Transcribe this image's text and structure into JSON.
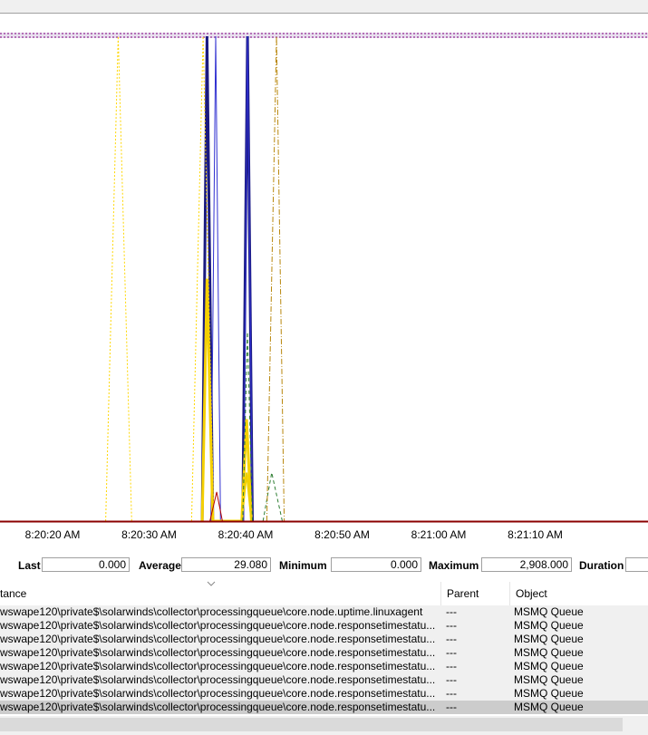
{
  "chart_data": {
    "type": "line",
    "x_tick_labels": [
      "8:20:20 AM",
      "8:20:30 AM",
      "8:20:40 AM",
      "8:20:50 AM",
      "8:21:00 AM",
      "8:21:10 AM"
    ],
    "grid": false,
    "vertical_scale": "100 = top of plot",
    "series": [
      {
        "color": "#1a1a80",
        "style": "solid-thick",
        "points": [
          [
            "8:20:35.5",
            0
          ],
          [
            "8:20:36",
            100
          ],
          [
            "8:20:36.6",
            0
          ],
          [
            "8:20:39.7",
            0
          ],
          [
            "8:20:40.2",
            100
          ],
          [
            "8:20:40.7",
            0
          ]
        ]
      },
      {
        "color": "#2f2fd0",
        "style": "solid-thin",
        "points": [
          [
            "8:20:36.4",
            0
          ],
          [
            "8:20:36.9",
            100
          ],
          [
            "8:20:37.4",
            0
          ],
          [
            "8:20:39.8",
            0
          ],
          [
            "8:20:40.2",
            100
          ],
          [
            "8:20:40.7",
            0
          ]
        ]
      },
      {
        "color": "#f5d000",
        "style": "solid-thick",
        "points": [
          [
            "8:20:35.5",
            0
          ],
          [
            "8:20:36",
            50
          ],
          [
            "8:20:36.6",
            0
          ],
          [
            "8:20:39.6",
            0
          ],
          [
            "8:20:40.1",
            21
          ],
          [
            "8:20:40.6",
            0
          ]
        ]
      },
      {
        "color": "#f0d000",
        "style": "solid-medium",
        "points": [
          [
            "8:20:39.6",
            0
          ],
          [
            "8:20:40.1",
            10
          ],
          [
            "8:20:40.6",
            0
          ]
        ]
      },
      {
        "color": "#ffd700",
        "style": "dotted",
        "points": [
          [
            "8:20:25.5",
            0
          ],
          [
            "8:20:26.8",
            100
          ],
          [
            "8:20:28.2",
            0
          ]
        ]
      },
      {
        "color": "#ffd700",
        "style": "dotted",
        "points": [
          [
            "8:20:34.4",
            0
          ],
          [
            "8:20:35.6",
            100
          ],
          [
            "8:20:36.7",
            0
          ]
        ]
      },
      {
        "color": "#2e7d32",
        "style": "dashed",
        "points": [
          [
            "8:20:39.7",
            0
          ],
          [
            "8:20:40.2",
            39
          ],
          [
            "8:20:40.7",
            0
          ]
        ]
      },
      {
        "color": "#2e7d32",
        "style": "dashed",
        "points": [
          [
            "8:20:41.8",
            0
          ],
          [
            "8:20:42.7",
            10
          ],
          [
            "8:20:43.8",
            0
          ]
        ]
      },
      {
        "color": "#b8860b",
        "style": "dash-dot",
        "points": [
          [
            "8:20:42.2",
            0
          ],
          [
            "8:20:43.2",
            100
          ],
          [
            "8:20:44",
            0
          ]
        ]
      },
      {
        "color": "#b30000",
        "style": "solid-thin",
        "points": [
          [
            "8:20:36.3",
            0
          ],
          [
            "8:20:37",
            6
          ],
          [
            "8:20:37.6",
            0
          ]
        ]
      }
    ]
  },
  "stats": {
    "last_label": "Last",
    "last_value": "0.000",
    "average_label": "Average",
    "average_value": "29.080",
    "minimum_label": "Minimum",
    "minimum_value": "0.000",
    "maximum_label": "Maximum",
    "maximum_value": "2,908.000",
    "duration_label": "Duration",
    "duration_value": ""
  },
  "counter_list": {
    "columns": [
      "tance",
      "Parent",
      "Object"
    ],
    "rows": [
      {
        "instance": "wswape120\\private$\\solarwinds\\collector\\processingqueue\\core.node.uptime.linuxagent",
        "parent": "---",
        "object": "MSMQ Queue",
        "selected": false
      },
      {
        "instance": "wswape120\\private$\\solarwinds\\collector\\processingqueue\\core.node.responsetimestatu...",
        "parent": "---",
        "object": "MSMQ Queue",
        "selected": false
      },
      {
        "instance": "wswape120\\private$\\solarwinds\\collector\\processingqueue\\core.node.responsetimestatu...",
        "parent": "---",
        "object": "MSMQ Queue",
        "selected": false
      },
      {
        "instance": "wswape120\\private$\\solarwinds\\collector\\processingqueue\\core.node.responsetimestatu...",
        "parent": "---",
        "object": "MSMQ Queue",
        "selected": false
      },
      {
        "instance": "wswape120\\private$\\solarwinds\\collector\\processingqueue\\core.node.responsetimestatu...",
        "parent": "---",
        "object": "MSMQ Queue",
        "selected": false
      },
      {
        "instance": "wswape120\\private$\\solarwinds\\collector\\processingqueue\\core.node.responsetimestatu...",
        "parent": "---",
        "object": "MSMQ Queue",
        "selected": false
      },
      {
        "instance": "wswape120\\private$\\solarwinds\\collector\\processingqueue\\core.node.responsetimestatu...",
        "parent": "---",
        "object": "MSMQ Queue",
        "selected": false
      },
      {
        "instance": "wswape120\\private$\\solarwinds\\collector\\processingqueue\\core.node.responsetimestatu...",
        "parent": "---",
        "object": "MSMQ Queue",
        "selected": true
      }
    ]
  },
  "icons": {
    "sort": "chevron-down-icon"
  },
  "colors": {
    "axis_line": "#8b0000",
    "limit_band": "#800080",
    "selected_row": "#cccccc",
    "row_bg": "#f0f0f0"
  }
}
